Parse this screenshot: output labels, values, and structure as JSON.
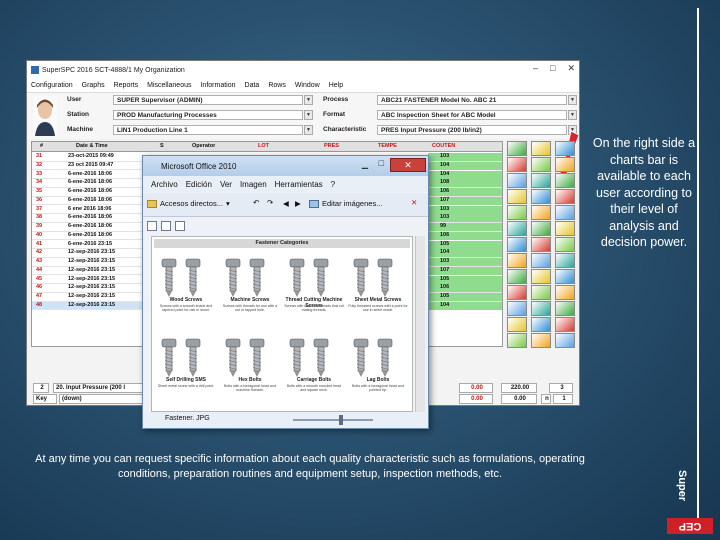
{
  "app": {
    "title": "SuperSPC 2016 SCT-4888/1 My Organization",
    "menu": [
      "Configuration",
      "Graphs",
      "Reports",
      "Miscellaneous",
      "Information",
      "Data",
      "Rows",
      "Window",
      "Help"
    ],
    "info": {
      "user_label": "User",
      "user_value": "SUPER Supervisor (ADMIN)",
      "station_label": "Station",
      "station_value": "PROD Manufacturing Processes",
      "machine_label": "Machine",
      "machine_value": "LIN1 Production Line 1",
      "process_label": "Process",
      "process_value": "ABC21 FASTENER Model No. ABC 21",
      "format_label": "Format",
      "format_value": "ABC Inspection Sheet for ABC Model",
      "characteristic_label": "Characteristic",
      "characteristic_value": "PRES Input Pressure (200 lb/in2)"
    },
    "table": {
      "headers": [
        "#",
        "Date & Time",
        "S",
        "Operator",
        "LOT",
        "PRES",
        "TEMPE",
        "COUTEN"
      ],
      "rows": [
        {
          "num": "31",
          "date": "23-oct-2015 09:49",
          "value": "103"
        },
        {
          "num": "32",
          "date": "23 oct 2015 09:47",
          "value": "104"
        },
        {
          "num": "33",
          "date": "6-ene-2016 18:06",
          "value": "104"
        },
        {
          "num": "34",
          "date": "6-ene-2016 18:06",
          "value": "108"
        },
        {
          "num": "35",
          "date": "6-ene-2016 18:06",
          "value": "106"
        },
        {
          "num": "36",
          "date": "6-ene-2016 18:06",
          "value": "107"
        },
        {
          "num": "37",
          "date": "6 ene 2016 18:06",
          "value": "103"
        },
        {
          "num": "38",
          "date": "6-ene-2016 18:06",
          "value": "103"
        },
        {
          "num": "39",
          "date": "6-ene-2016 18:06",
          "value": "99"
        },
        {
          "num": "40",
          "date": "6-ene-2016 18:06",
          "value": "106"
        },
        {
          "num": "41",
          "date": "6-ene-2016 23:15",
          "value": "105"
        },
        {
          "num": "42",
          "date": "12-sep-2016 23:15",
          "value": "104"
        },
        {
          "num": "43",
          "date": "12-sep-2016 23:15",
          "value": "103"
        },
        {
          "num": "44",
          "date": "12-sep-2016 23:15",
          "value": "107"
        },
        {
          "num": "45",
          "date": "12-sep-2016 23:15",
          "value": "105"
        },
        {
          "num": "46",
          "date": "12-sep-2016 23:15",
          "value": "106"
        },
        {
          "num": "47",
          "date": "12-sep-2016 23:15",
          "value": "105"
        },
        {
          "num": "48",
          "date": "12-sep-2016 23:15",
          "value": "104"
        }
      ]
    },
    "bottom": {
      "r1_index": "2",
      "r1_label": "20. Input Pressure (200 l",
      "r1_v1": "0.00",
      "r1_v2": "220.00",
      "r1_v3": "3",
      "r2_key": "Key",
      "r2_value": "(down)",
      "r2_v1": "0.00",
      "r2_v2": "0.00",
      "r2_n": "n",
      "r2_v3": "1"
    }
  },
  "popup": {
    "title": "Microsoft Office 2010",
    "close": "✕",
    "minimize": "▁",
    "maximize": "□",
    "menu": [
      "Archivo",
      "Edición",
      "Ver",
      "Imagen",
      "Herramientas",
      "?"
    ],
    "tools": {
      "shortcuts": "Accesos directos...",
      "edit_images": "Editar imágenes..."
    },
    "doc": {
      "header": "Fastener Categories",
      "items": [
        {
          "title": "Wood Screws",
          "desc": "Screws with a smooth shank and tapered point for use in wood."
        },
        {
          "title": "Machine Screws",
          "desc": "Screws with threads for use with a nut or tapped hole."
        },
        {
          "title": "Thread Cutting Machine Screws",
          "desc": "Screws with machine threads that cut mating threads."
        },
        {
          "title": "Sheet Metal Screws",
          "desc": "Fully threaded screws with a point for use in sheet metal."
        },
        {
          "title": "Self Drilling SMS",
          "desc": "Sheet metal screw with a drill point."
        },
        {
          "title": "Hex Bolts",
          "desc": "Bolts with a hexagonal head and machine threads."
        },
        {
          "title": "Carriage Bolts",
          "desc": "Bolts with a smooth rounded head and square neck."
        },
        {
          "title": "Lag Bolts",
          "desc": "Bolts with a hexagonal head and pointed tip."
        }
      ]
    },
    "status": "Fastener. JPG"
  },
  "notes": {
    "right": "On the right side a charts bar is available to each user according to their level of analysis and decision power.",
    "bottom": "At any time you can request specific information about each quality characteristic such as formulations, operating conditions, preparation routines and equipment setup, inspection methods, etc."
  },
  "brand": {
    "super": "Super",
    "cep": "CEP",
    "red": "#d01f26"
  },
  "colors": {
    "background": "#2a5270",
    "highlight_green": "#8fdc8f",
    "row_number_red": "#c01818",
    "arrow_red": "#d8262b"
  }
}
